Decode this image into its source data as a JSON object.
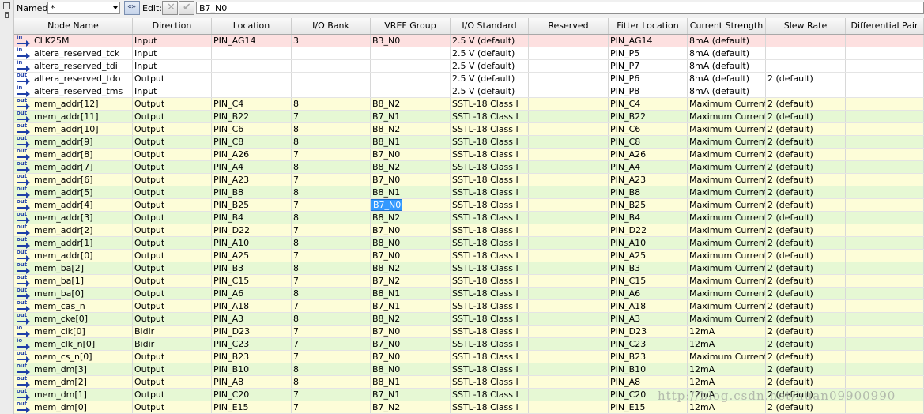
{
  "toolbar": {
    "named_label": "Named:",
    "named_value": "*",
    "edit_label": "Edit:",
    "edit_value": "B7_N0"
  },
  "columns": [
    "Node Name",
    "Direction",
    "Location",
    "I/O Bank",
    "VREF Group",
    "I/O Standard",
    "Reserved",
    "Fitter Location",
    "Current Strength",
    "Slew Rate",
    "Differential Pair"
  ],
  "rows": [
    {
      "icon": "in",
      "name": "CLK25M",
      "dir": "Input",
      "loc": "PIN_AG14",
      "bank": "3",
      "vref": "B3_N0",
      "std": "2.5 V (default)",
      "res": "",
      "fit": "PIN_AG14",
      "cur": "8mA (default)",
      "slew": "",
      "diff": "",
      "style": "sys"
    },
    {
      "icon": "in",
      "name": "altera_reserved_tck",
      "dir": "Input",
      "loc": "",
      "bank": "",
      "vref": "",
      "std": "2.5 V (default)",
      "res": "",
      "fit": "PIN_P5",
      "cur": "8mA (default)",
      "slew": "",
      "diff": "",
      "style": "white"
    },
    {
      "icon": "in",
      "name": "altera_reserved_tdi",
      "dir": "Input",
      "loc": "",
      "bank": "",
      "vref": "",
      "std": "2.5 V (default)",
      "res": "",
      "fit": "PIN_P7",
      "cur": "8mA (default)",
      "slew": "",
      "diff": "",
      "style": "white"
    },
    {
      "icon": "out",
      "name": "altera_reserved_tdo",
      "dir": "Output",
      "loc": "",
      "bank": "",
      "vref": "",
      "std": "2.5 V (default)",
      "res": "",
      "fit": "PIN_P6",
      "cur": "8mA (default)",
      "slew": "2 (default)",
      "diff": "",
      "style": "white"
    },
    {
      "icon": "in",
      "name": "altera_reserved_tms",
      "dir": "Input",
      "loc": "",
      "bank": "",
      "vref": "",
      "std": "2.5 V (default)",
      "res": "",
      "fit": "PIN_P8",
      "cur": "8mA (default)",
      "slew": "",
      "diff": "",
      "style": "white"
    },
    {
      "icon": "out",
      "name": "mem_addr[12]",
      "dir": "Output",
      "loc": "PIN_C4",
      "bank": "8",
      "vref": "B8_N2",
      "std": "SSTL-18 Class I",
      "res": "",
      "fit": "PIN_C4",
      "cur": "Maximum Current",
      "slew": "2 (default)",
      "diff": "",
      "style": "y"
    },
    {
      "icon": "out",
      "name": "mem_addr[11]",
      "dir": "Output",
      "loc": "PIN_B22",
      "bank": "7",
      "vref": "B7_N1",
      "std": "SSTL-18 Class I",
      "res": "",
      "fit": "PIN_B22",
      "cur": "Maximum Current",
      "slew": "2 (default)",
      "diff": "",
      "style": "g"
    },
    {
      "icon": "out",
      "name": "mem_addr[10]",
      "dir": "Output",
      "loc": "PIN_C6",
      "bank": "8",
      "vref": "B8_N2",
      "std": "SSTL-18 Class I",
      "res": "",
      "fit": "PIN_C6",
      "cur": "Maximum Current",
      "slew": "2 (default)",
      "diff": "",
      "style": "y"
    },
    {
      "icon": "out",
      "name": "mem_addr[9]",
      "dir": "Output",
      "loc": "PIN_C8",
      "bank": "8",
      "vref": "B8_N1",
      "std": "SSTL-18 Class I",
      "res": "",
      "fit": "PIN_C8",
      "cur": "Maximum Current",
      "slew": "2 (default)",
      "diff": "",
      "style": "g"
    },
    {
      "icon": "out",
      "name": "mem_addr[8]",
      "dir": "Output",
      "loc": "PIN_A26",
      "bank": "7",
      "vref": "B7_N0",
      "std": "SSTL-18 Class I",
      "res": "",
      "fit": "PIN_A26",
      "cur": "Maximum Current",
      "slew": "2 (default)",
      "diff": "",
      "style": "y"
    },
    {
      "icon": "out",
      "name": "mem_addr[7]",
      "dir": "Output",
      "loc": "PIN_A4",
      "bank": "8",
      "vref": "B8_N2",
      "std": "SSTL-18 Class I",
      "res": "",
      "fit": "PIN_A4",
      "cur": "Maximum Current",
      "slew": "2 (default)",
      "diff": "",
      "style": "g"
    },
    {
      "icon": "out",
      "name": "mem_addr[6]",
      "dir": "Output",
      "loc": "PIN_A23",
      "bank": "7",
      "vref": "B7_N0",
      "std": "SSTL-18 Class I",
      "res": "",
      "fit": "PIN_A23",
      "cur": "Maximum Current",
      "slew": "2 (default)",
      "diff": "",
      "style": "y"
    },
    {
      "icon": "out",
      "name": "mem_addr[5]",
      "dir": "Output",
      "loc": "PIN_B8",
      "bank": "8",
      "vref": "B8_N1",
      "std": "SSTL-18 Class I",
      "res": "",
      "fit": "PIN_B8",
      "cur": "Maximum Current",
      "slew": "2 (default)",
      "diff": "",
      "style": "g"
    },
    {
      "icon": "out",
      "name": "mem_addr[4]",
      "dir": "Output",
      "loc": "PIN_B25",
      "bank": "7",
      "vref": "B7_N0",
      "std": "SSTL-18 Class I",
      "res": "",
      "fit": "PIN_B25",
      "cur": "Maximum Current",
      "slew": "2 (default)",
      "diff": "",
      "style": "y",
      "selected": true
    },
    {
      "icon": "out",
      "name": "mem_addr[3]",
      "dir": "Output",
      "loc": "PIN_B4",
      "bank": "8",
      "vref": "B8_N2",
      "std": "SSTL-18 Class I",
      "res": "",
      "fit": "PIN_B4",
      "cur": "Maximum Current",
      "slew": "2 (default)",
      "diff": "",
      "style": "g"
    },
    {
      "icon": "out",
      "name": "mem_addr[2]",
      "dir": "Output",
      "loc": "PIN_D22",
      "bank": "7",
      "vref": "B7_N0",
      "std": "SSTL-18 Class I",
      "res": "",
      "fit": "PIN_D22",
      "cur": "Maximum Current",
      "slew": "2 (default)",
      "diff": "",
      "style": "y"
    },
    {
      "icon": "out",
      "name": "mem_addr[1]",
      "dir": "Output",
      "loc": "PIN_A10",
      "bank": "8",
      "vref": "B8_N0",
      "std": "SSTL-18 Class I",
      "res": "",
      "fit": "PIN_A10",
      "cur": "Maximum Current",
      "slew": "2 (default)",
      "diff": "",
      "style": "g"
    },
    {
      "icon": "out",
      "name": "mem_addr[0]",
      "dir": "Output",
      "loc": "PIN_A25",
      "bank": "7",
      "vref": "B7_N0",
      "std": "SSTL-18 Class I",
      "res": "",
      "fit": "PIN_A25",
      "cur": "Maximum Current",
      "slew": "2 (default)",
      "diff": "",
      "style": "y"
    },
    {
      "icon": "out",
      "name": "mem_ba[2]",
      "dir": "Output",
      "loc": "PIN_B3",
      "bank": "8",
      "vref": "B8_N2",
      "std": "SSTL-18 Class I",
      "res": "",
      "fit": "PIN_B3",
      "cur": "Maximum Current",
      "slew": "2 (default)",
      "diff": "",
      "style": "g"
    },
    {
      "icon": "out",
      "name": "mem_ba[1]",
      "dir": "Output",
      "loc": "PIN_C15",
      "bank": "7",
      "vref": "B7_N2",
      "std": "SSTL-18 Class I",
      "res": "",
      "fit": "PIN_C15",
      "cur": "Maximum Current",
      "slew": "2 (default)",
      "diff": "",
      "style": "y"
    },
    {
      "icon": "out",
      "name": "mem_ba[0]",
      "dir": "Output",
      "loc": "PIN_A6",
      "bank": "8",
      "vref": "B8_N1",
      "std": "SSTL-18 Class I",
      "res": "",
      "fit": "PIN_A6",
      "cur": "Maximum Current",
      "slew": "2 (default)",
      "diff": "",
      "style": "g"
    },
    {
      "icon": "out",
      "name": "mem_cas_n",
      "dir": "Output",
      "loc": "PIN_A18",
      "bank": "7",
      "vref": "B7_N1",
      "std": "SSTL-18 Class I",
      "res": "",
      "fit": "PIN_A18",
      "cur": "Maximum Current",
      "slew": "2 (default)",
      "diff": "",
      "style": "y"
    },
    {
      "icon": "out",
      "name": "mem_cke[0]",
      "dir": "Output",
      "loc": "PIN_A3",
      "bank": "8",
      "vref": "B8_N2",
      "std": "SSTL-18 Class I",
      "res": "",
      "fit": "PIN_A3",
      "cur": "Maximum Current",
      "slew": "2 (default)",
      "diff": "",
      "style": "g"
    },
    {
      "icon": "io",
      "name": "mem_clk[0]",
      "dir": "Bidir",
      "loc": "PIN_D23",
      "bank": "7",
      "vref": "B7_N0",
      "std": "SSTL-18 Class I",
      "res": "",
      "fit": "PIN_D23",
      "cur": "12mA",
      "slew": "2 (default)",
      "diff": "",
      "style": "y"
    },
    {
      "icon": "io",
      "name": "mem_clk_n[0]",
      "dir": "Bidir",
      "loc": "PIN_C23",
      "bank": "7",
      "vref": "B7_N0",
      "std": "SSTL-18 Class I",
      "res": "",
      "fit": "PIN_C23",
      "cur": "12mA",
      "slew": "2 (default)",
      "diff": "",
      "style": "g"
    },
    {
      "icon": "out",
      "name": "mem_cs_n[0]",
      "dir": "Output",
      "loc": "PIN_B23",
      "bank": "7",
      "vref": "B7_N0",
      "std": "SSTL-18 Class I",
      "res": "",
      "fit": "PIN_B23",
      "cur": "Maximum Current",
      "slew": "2 (default)",
      "diff": "",
      "style": "y"
    },
    {
      "icon": "out",
      "name": "mem_dm[3]",
      "dir": "Output",
      "loc": "PIN_B10",
      "bank": "8",
      "vref": "B8_N0",
      "std": "SSTL-18 Class I",
      "res": "",
      "fit": "PIN_B10",
      "cur": "12mA",
      "slew": "2 (default)",
      "diff": "",
      "style": "g"
    },
    {
      "icon": "out",
      "name": "mem_dm[2]",
      "dir": "Output",
      "loc": "PIN_A8",
      "bank": "8",
      "vref": "B8_N1",
      "std": "SSTL-18 Class I",
      "res": "",
      "fit": "PIN_A8",
      "cur": "12mA",
      "slew": "2 (default)",
      "diff": "",
      "style": "y"
    },
    {
      "icon": "out",
      "name": "mem_dm[1]",
      "dir": "Output",
      "loc": "PIN_C20",
      "bank": "7",
      "vref": "B7_N1",
      "std": "SSTL-18 Class I",
      "res": "",
      "fit": "PIN_C20",
      "cur": "12mA",
      "slew": "2 (default)",
      "diff": "",
      "style": "g"
    },
    {
      "icon": "out",
      "name": "mem_dm[0]",
      "dir": "Output",
      "loc": "PIN_E15",
      "bank": "7",
      "vref": "B7_N2",
      "std": "SSTL-18 Class I",
      "res": "",
      "fit": "PIN_E15",
      "cur": "12mA",
      "slew": "2 (default)",
      "diff": "",
      "style": "y"
    }
  ],
  "watermark": "http://blog.csdn.net/huan09900990"
}
